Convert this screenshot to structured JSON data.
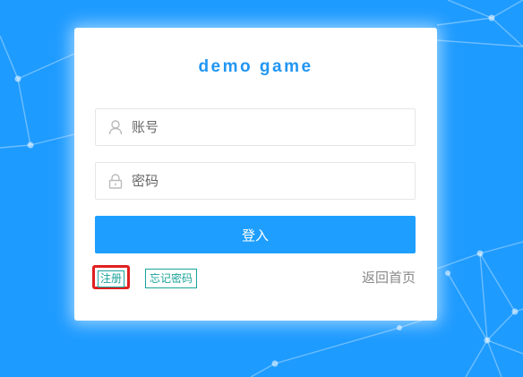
{
  "app": {
    "title": "demo game"
  },
  "colors": {
    "background": "#1e9bff",
    "accent": "#1e9fff",
    "link": "#1aa39a"
  },
  "login_form": {
    "account": {
      "placeholder": "账号",
      "value": "",
      "icon": "user-icon"
    },
    "password": {
      "placeholder": "密码",
      "value": "",
      "icon": "lock-icon"
    },
    "submit_label": "登入"
  },
  "links": {
    "register": "注册",
    "forgot_password": "忘记密码",
    "back_home": "返回首页"
  }
}
